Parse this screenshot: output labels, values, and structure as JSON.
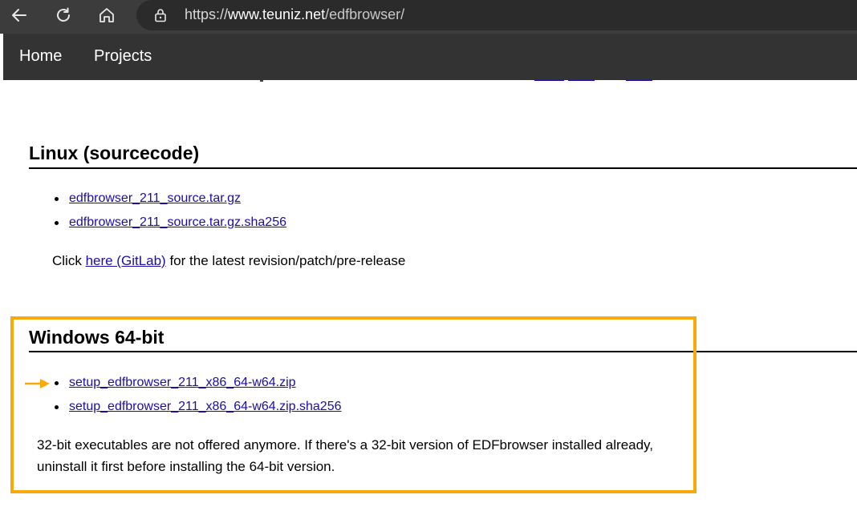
{
  "browser": {
    "url_scheme": "https://",
    "url_host": "www.teuniz.net",
    "url_path": "/edfbrowser/"
  },
  "site_nav": {
    "items": [
      "Home",
      "Projects"
    ]
  },
  "linux_section": {
    "heading": "Linux (sourcecode)",
    "links": [
      "edfbrowser_211_source.tar.gz",
      "edfbrowser_211_source.tar.gz.sha256"
    ],
    "note_prefix": "Click ",
    "note_link": "here (GitLab)",
    "note_suffix": " for the latest revision/patch/pre-release"
  },
  "windows_section": {
    "heading": "Windows 64-bit",
    "links": [
      "setup_edfbrowser_211_x86_64-w64.zip",
      "setup_edfbrowser_211_x86_64-w64.zip.sha256"
    ],
    "note_line1": "32-bit executables are not offered anymore. If there's a 32-bit version of EDFbrowser installed already,",
    "note_line2": "uninstall it first before installing the 64-bit version."
  },
  "colors": {
    "highlight": "#f9a908",
    "link": "#1a0dab",
    "nav_bg": "#333333"
  },
  "icons": [
    "back-arrow-icon",
    "reload-icon",
    "home-icon",
    "lock-icon",
    "pointer-arrow-icon"
  ]
}
